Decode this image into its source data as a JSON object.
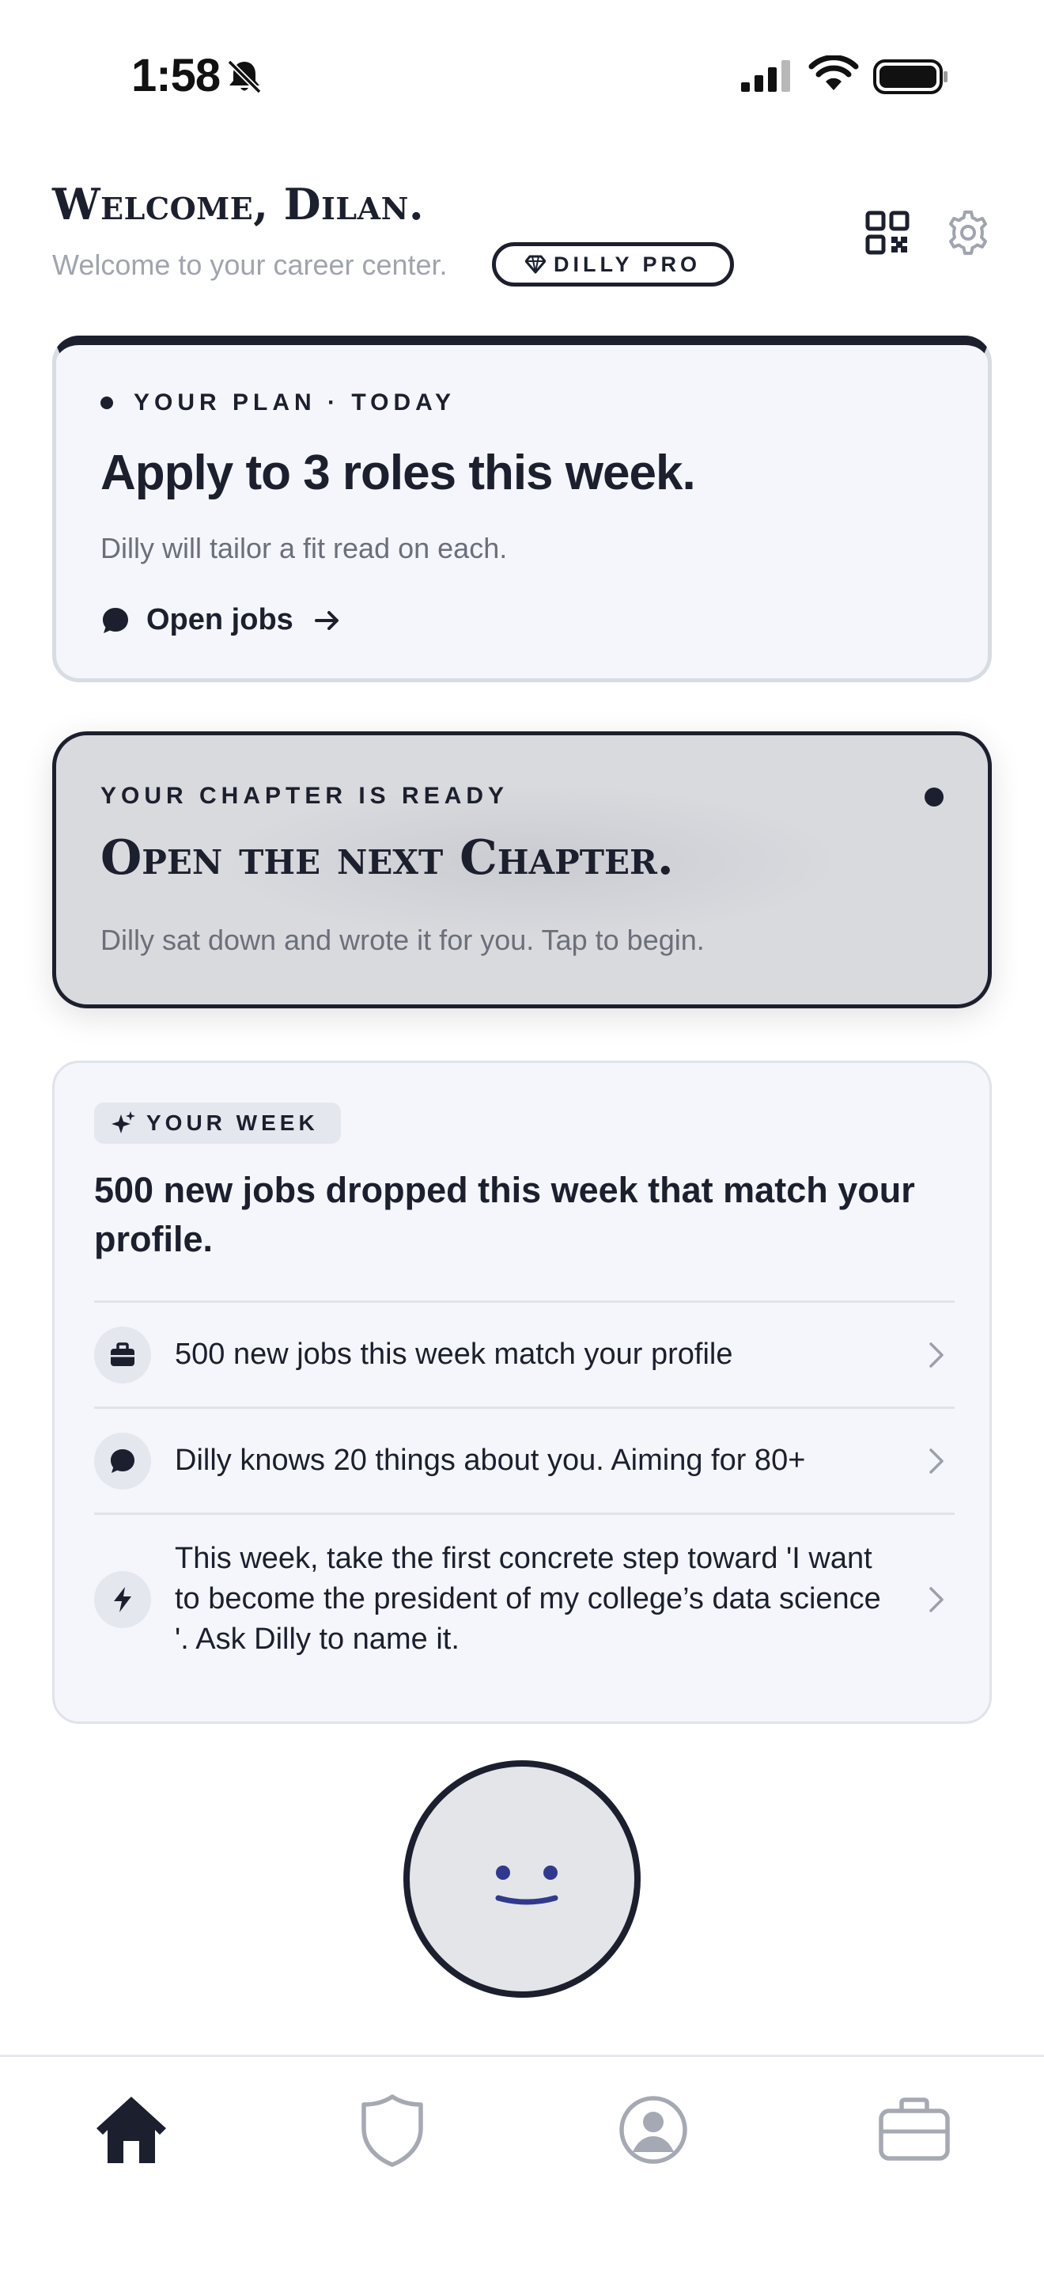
{
  "status_bar": {
    "time": "1:58"
  },
  "header": {
    "title": "Welcome, Dilan.",
    "subtitle": "Welcome to your career center.",
    "badge_label": "DILLY PRO"
  },
  "plan_card": {
    "eyebrow": "YOUR PLAN · TODAY",
    "title": "Apply to 3 roles this week.",
    "subtitle": "Dilly will tailor a fit read on each.",
    "link_label": "Open jobs"
  },
  "chapter_card": {
    "eyebrow": "YOUR CHAPTER IS READY",
    "title": "Open the next Chapter.",
    "subtitle": "Dilly sat down and wrote it for you. Tap to begin."
  },
  "week_card": {
    "tag": "YOUR WEEK",
    "headline": "500 new jobs dropped this week that match your profile.",
    "items": [
      {
        "icon": "briefcase-icon",
        "text": "500 new jobs this week match your profile"
      },
      {
        "icon": "chat-bubble-icon",
        "text": "Dilly knows 20 things about you. Aiming for 80+"
      },
      {
        "icon": "lightning-icon",
        "text": "This week, take the first concrete step toward 'I want to become the president of my college’s data science '. Ask Dilly to name it."
      }
    ]
  },
  "bottom_nav": {
    "items": [
      "home-icon",
      "shield-icon",
      "profile-icon",
      "briefcase-icon"
    ],
    "active": "home-icon"
  },
  "colors": {
    "ink": "#1c1f2e",
    "card_bg": "#f4f6fb",
    "chapter_bg": "#d9dade",
    "muted_text": "#6b6f7a",
    "face_accent": "#2f3a8f"
  }
}
